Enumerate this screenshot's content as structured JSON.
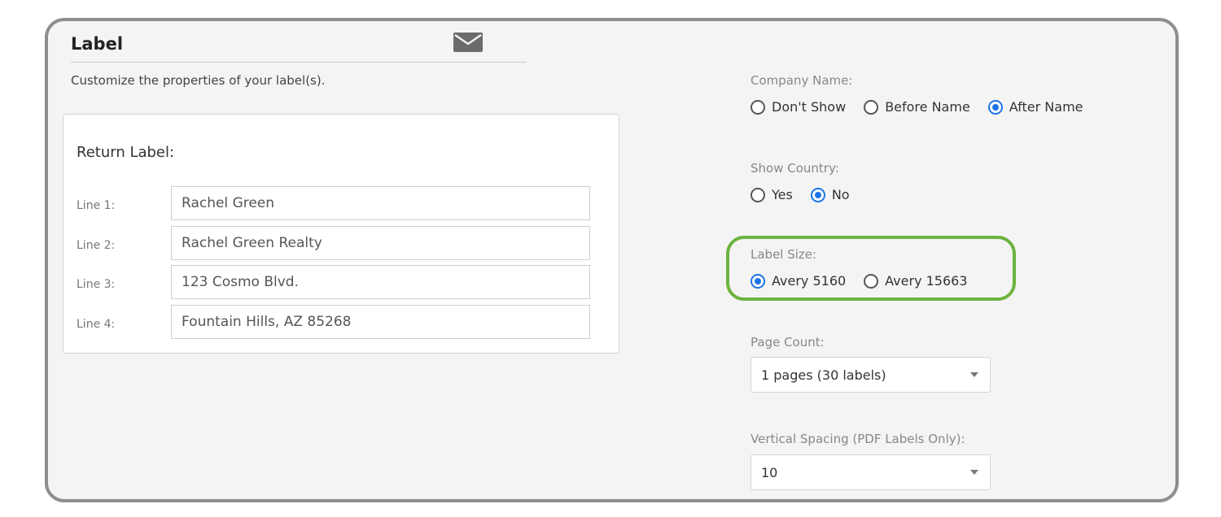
{
  "header": {
    "title": "Label",
    "subtitle": "Customize the properties of your label(s).",
    "mail_icon": "envelope-icon"
  },
  "return_label": {
    "title": "Return Label:",
    "lines": [
      {
        "label": "Line 1:",
        "value": "Rachel Green"
      },
      {
        "label": "Line 2:",
        "value": "Rachel Green Realty"
      },
      {
        "label": "Line 3:",
        "value": "123 Cosmo Blvd."
      },
      {
        "label": "Line 4:",
        "value": "Fountain Hills, AZ 85268"
      }
    ]
  },
  "company_name": {
    "label": "Company Name:",
    "options": [
      "Don't Show",
      "Before Name",
      "After Name"
    ],
    "selected": "After Name"
  },
  "show_country": {
    "label": "Show Country:",
    "options": [
      "Yes",
      "No"
    ],
    "selected": "No"
  },
  "label_size": {
    "label": "Label Size:",
    "options": [
      "Avery 5160",
      "Avery 15663"
    ],
    "selected": "Avery 5160"
  },
  "page_count": {
    "label": "Page Count:",
    "value": "1 pages (30 labels)"
  },
  "vertical_spacing": {
    "label": "Vertical Spacing (PDF Labels Only):",
    "value": "10"
  },
  "colors": {
    "accent": "#1a73e8",
    "highlight": "#6db33f",
    "border": "#8e8e8e"
  }
}
